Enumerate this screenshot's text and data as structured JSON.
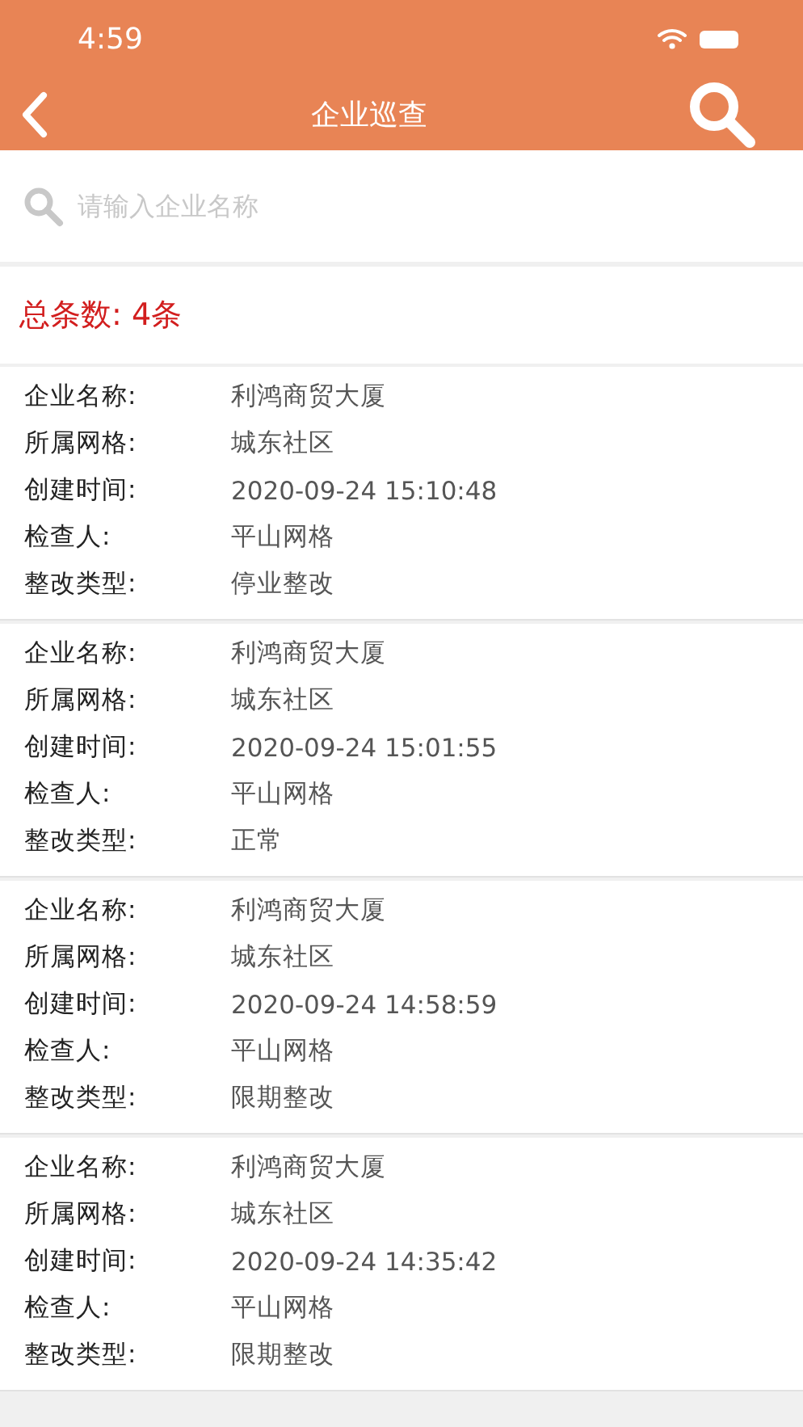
{
  "status_bar": {
    "time": "4:59"
  },
  "nav": {
    "title": "企业巡查"
  },
  "search": {
    "placeholder": "请输入企业名称"
  },
  "total": "总条数: 4条",
  "records": [
    {
      "fields": [
        {
          "label": "企业名称:",
          "value": "利鸿商贸大厦"
        },
        {
          "label": "所属网格:",
          "value": "城东社区"
        },
        {
          "label": "创建时间:",
          "value": "2020-09-24 15:10:48"
        },
        {
          "label": "检查人:",
          "value": "平山网格"
        },
        {
          "label": "整改类型:",
          "value": "停业整改"
        }
      ]
    },
    {
      "fields": [
        {
          "label": "企业名称:",
          "value": "利鸿商贸大厦"
        },
        {
          "label": "所属网格:",
          "value": "城东社区"
        },
        {
          "label": "创建时间:",
          "value": "2020-09-24 15:01:55"
        },
        {
          "label": "检查人:",
          "value": "平山网格"
        },
        {
          "label": "整改类型:",
          "value": "正常"
        }
      ]
    },
    {
      "fields": [
        {
          "label": "企业名称:",
          "value": "利鸿商贸大厦"
        },
        {
          "label": "所属网格:",
          "value": "城东社区"
        },
        {
          "label": "创建时间:",
          "value": "2020-09-24 14:58:59"
        },
        {
          "label": "检查人:",
          "value": "平山网格"
        },
        {
          "label": "整改类型:",
          "value": "限期整改"
        }
      ]
    },
    {
      "fields": [
        {
          "label": "企业名称:",
          "value": "利鸿商贸大厦"
        },
        {
          "label": "所属网格:",
          "value": "城东社区"
        },
        {
          "label": "创建时间:",
          "value": "2020-09-24 14:35:42"
        },
        {
          "label": "检查人:",
          "value": "平山网格"
        },
        {
          "label": "整改类型:",
          "value": "限期整改"
        }
      ]
    }
  ]
}
